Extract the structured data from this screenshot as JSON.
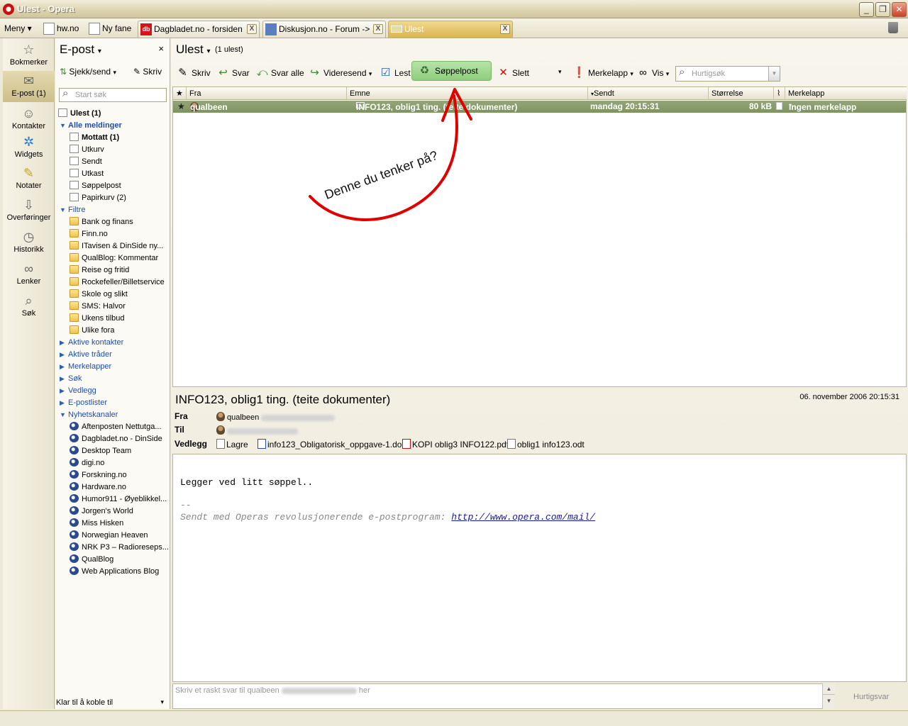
{
  "window": {
    "title": "Ulest - Opera",
    "min": "_",
    "max": "❐",
    "close": "✕"
  },
  "tabs": {
    "menu": "Meny",
    "items": [
      {
        "label": "hw.no"
      },
      {
        "label": "Ny fane"
      },
      {
        "label": "Dagbladet.no - forsiden"
      },
      {
        "label": "Diskusjon.no - Forum -> ..."
      },
      {
        "label": "Ulest"
      }
    ],
    "close": "X"
  },
  "panels": {
    "items": [
      {
        "label": "Bokmerker",
        "icon": "☆"
      },
      {
        "label": "E-post (1)",
        "icon": "✉"
      },
      {
        "label": "Kontakter",
        "icon": "☺"
      },
      {
        "label": "Widgets",
        "icon": "✲"
      },
      {
        "label": "Notater",
        "icon": "✎"
      },
      {
        "label": "Overføringer",
        "icon": "⇩"
      },
      {
        "label": "Historikk",
        "icon": "◷"
      },
      {
        "label": "Lenker",
        "icon": "∞"
      },
      {
        "label": "Søk",
        "icon": "⌕"
      }
    ]
  },
  "mailpanel": {
    "title": "E-post",
    "close": "×",
    "check_send": "Sjekk/send",
    "compose": "Skriv",
    "search_placeholder": "Start søk",
    "status": "Klar til å koble til"
  },
  "tree": [
    {
      "label": "Ulest (1)",
      "kind": "item",
      "bold": true
    },
    {
      "label": "Alle meldinger",
      "kind": "section-open",
      "bold": true
    },
    {
      "label": "Mottatt (1)",
      "kind": "item",
      "bold": true
    },
    {
      "label": "Utkurv",
      "kind": "item"
    },
    {
      "label": "Sendt",
      "kind": "item"
    },
    {
      "label": "Utkast",
      "kind": "item"
    },
    {
      "label": "Søppelpost",
      "kind": "item"
    },
    {
      "label": "Papirkurv (2)",
      "kind": "item"
    },
    {
      "label": "Filtre",
      "kind": "section-open"
    },
    {
      "label": "Bank og finans",
      "kind": "folder"
    },
    {
      "label": "Finn.no",
      "kind": "folder"
    },
    {
      "label": "ITavisen & DinSide ny...",
      "kind": "folder"
    },
    {
      "label": "QualBlog: Kommentar",
      "kind": "folder"
    },
    {
      "label": "Reise og fritid",
      "kind": "folder"
    },
    {
      "label": "Rockefeller/Billetservice",
      "kind": "folder"
    },
    {
      "label": "Skole og slikt",
      "kind": "folder"
    },
    {
      "label": "SMS: Halvor",
      "kind": "folder"
    },
    {
      "label": "Ukens tilbud",
      "kind": "folder"
    },
    {
      "label": "Ulike fora",
      "kind": "folder"
    },
    {
      "label": "Aktive kontakter",
      "kind": "section"
    },
    {
      "label": "Aktive tråder",
      "kind": "section"
    },
    {
      "label": "Merkelapper",
      "kind": "section"
    },
    {
      "label": "Søk",
      "kind": "section"
    },
    {
      "label": "Vedlegg",
      "kind": "section"
    },
    {
      "label": "E-postlister",
      "kind": "section"
    },
    {
      "label": "Nyhetskanaler",
      "kind": "section-open"
    },
    {
      "label": "Aftenposten Nettutga...",
      "kind": "feed"
    },
    {
      "label": "Dagbladet.no - DinSide",
      "kind": "feed"
    },
    {
      "label": "Desktop Team",
      "kind": "feed"
    },
    {
      "label": "digi.no",
      "kind": "feed"
    },
    {
      "label": "Forskning.no",
      "kind": "feed"
    },
    {
      "label": "Hardware.no",
      "kind": "feed"
    },
    {
      "label": "Humor911 - Øyeblikkel...",
      "kind": "feed"
    },
    {
      "label": "Jorgen's World",
      "kind": "feed"
    },
    {
      "label": "Miss Hisken",
      "kind": "feed"
    },
    {
      "label": "Norwegian Heaven",
      "kind": "feed"
    },
    {
      "label": "NRK P3 – Radioreseps...",
      "kind": "feed"
    },
    {
      "label": "QualBlog",
      "kind": "feed"
    },
    {
      "label": "Web Applications Blog",
      "kind": "feed"
    }
  ],
  "main": {
    "title": "Ulest",
    "count": "(1 ulest)",
    "toolbar": {
      "compose": "Skriv",
      "reply": "Svar",
      "reply_all": "Svar alle",
      "forward": "Videresend",
      "read": "Lest",
      "spam": "Søppelpost",
      "delete": "Slett",
      "label": "Merkelapp",
      "view": "Vis",
      "quicksearch_placeholder": "Hurtigsøk"
    },
    "columns": {
      "star": "★",
      "from": "Fra",
      "subject": "Emne",
      "sent": "Sendt",
      "size": "Størrelse",
      "label": "Merkelapp"
    },
    "messages": [
      {
        "star": "★",
        "from": "qualbeen",
        "subject": "INFO123, oblig1 ting. (teite dokumenter)",
        "sent": "mandag 20:15:31",
        "size": "80 kB",
        "label": "Ingen merkelapp"
      }
    ]
  },
  "preview": {
    "subject": "INFO123, oblig1 ting. (teite dokumenter)",
    "date": "06. november 2006 20:15:31",
    "from_label": "Fra",
    "from": "qualbeen",
    "to_label": "Til",
    "attach_label": "Vedlegg",
    "save": "Lagre",
    "attachments": [
      "info123_Obligatorisk_oppgave-1.doc",
      "KOPI oblig3 INFO122.pdf",
      "oblig1 info123.odt"
    ],
    "body": "Legger ved litt søppel..",
    "sig_dash": "--",
    "sig_text": "Sendt med Operas revolusjonerende e-postprogram: ",
    "sig_link": "http://www.opera.com/mail/",
    "reply_prefix": "Skriv et raskt svar til qualbeen",
    "reply_suffix": "her",
    "quickreply_button": "Hurtigsvar"
  },
  "annotation": {
    "text": "Denne du tenker på?",
    "color": "#e00000"
  }
}
